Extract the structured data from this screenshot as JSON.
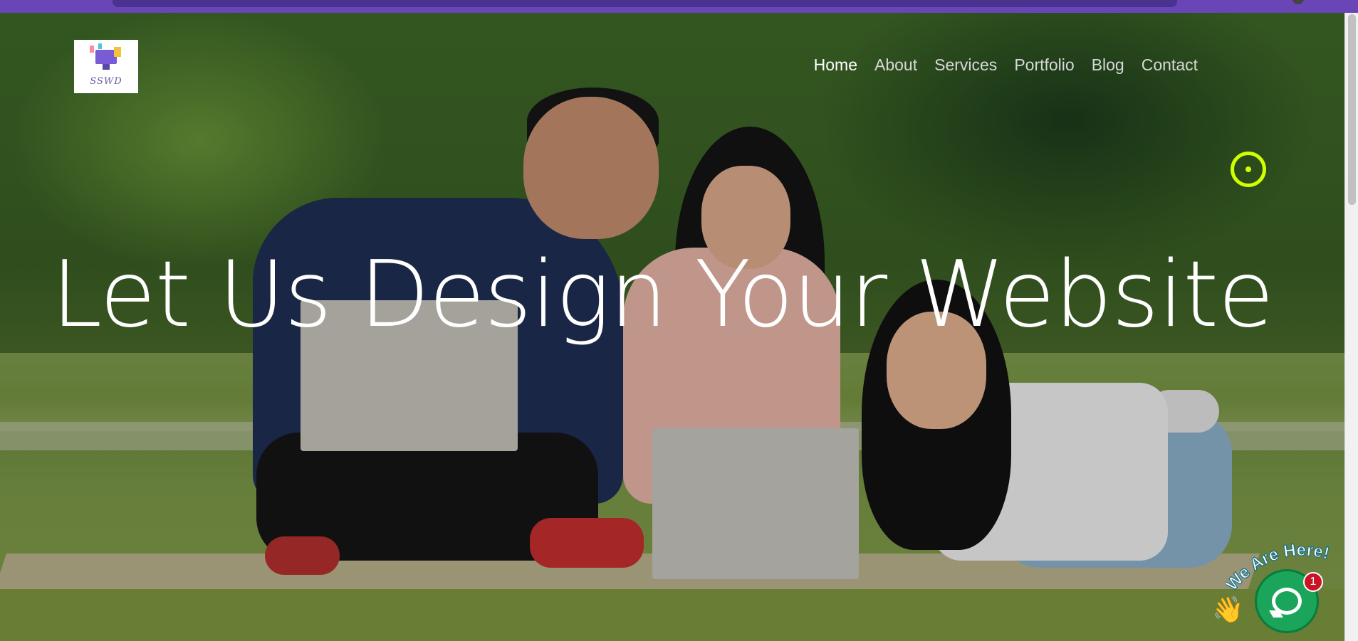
{
  "brand": {
    "logo_text": "SSWD"
  },
  "nav": {
    "items": [
      {
        "label": "Home",
        "active": true
      },
      {
        "label": "About"
      },
      {
        "label": "Services"
      },
      {
        "label": "Portfolio"
      },
      {
        "label": "Blog"
      },
      {
        "label": "Contact"
      }
    ]
  },
  "hero": {
    "headline": "Let Us Design Your Website"
  },
  "chat_widget": {
    "tagline": "We Are Here!",
    "badge_count": "1",
    "hand_icon": "waving-hand-icon",
    "chat_icon": "chat-bubble-icon"
  },
  "colors": {
    "accent_ring": "#cfff00",
    "chat_green": "#1aa55a",
    "badge_red": "#c81424",
    "browser_bar": "#6a45b8"
  }
}
